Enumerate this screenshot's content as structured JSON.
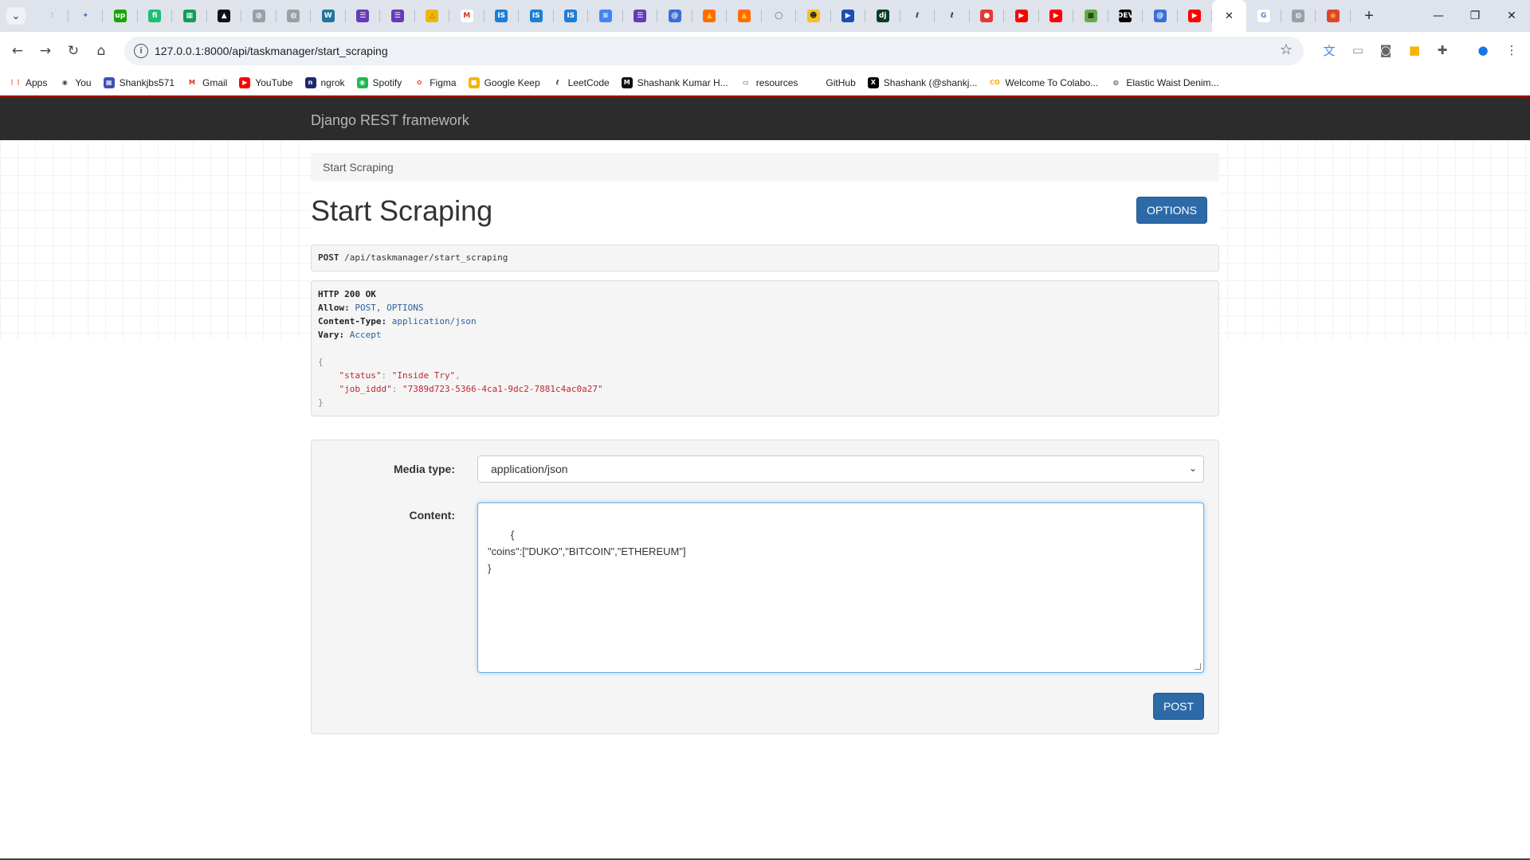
{
  "browser": {
    "tabs": [
      {
        "name": "moon",
        "glyph": "☽",
        "bg": "#dfe3eb",
        "fg": "#aab3c5"
      },
      {
        "name": "gemini",
        "glyph": "✦",
        "bg": "#dfe3eb",
        "fg": "#3b6fd6"
      },
      {
        "name": "upwork",
        "glyph": "up",
        "bg": "#14a800",
        "fg": "#ffffff"
      },
      {
        "name": "fiverr",
        "glyph": "fi",
        "bg": "#1dbf73",
        "fg": "#ffffff"
      },
      {
        "name": "sheets",
        "glyph": "▦",
        "bg": "#0f9d58",
        "fg": "#ffffff"
      },
      {
        "name": "notion-like",
        "glyph": "▲",
        "bg": "#111111",
        "fg": "#ffffff"
      },
      {
        "name": "globe-1",
        "glyph": "◍",
        "bg": "#9aa0a6",
        "fg": "#ffffff"
      },
      {
        "name": "globe-2",
        "glyph": "◍",
        "bg": "#9aa0a6",
        "fg": "#ffffff"
      },
      {
        "name": "wordpress",
        "glyph": "W",
        "bg": "#21759b",
        "fg": "#ffffff"
      },
      {
        "name": "forms-1",
        "glyph": "☰",
        "bg": "#673ab7",
        "fg": "#ffffff"
      },
      {
        "name": "forms-2",
        "glyph": "☰",
        "bg": "#673ab7",
        "fg": "#ffffff"
      },
      {
        "name": "drive",
        "glyph": "△",
        "bg": "#f4b400",
        "fg": "#0f9d58"
      },
      {
        "name": "gmail",
        "glyph": "M",
        "bg": "#ffffff",
        "fg": "#d93025"
      },
      {
        "name": "is-1",
        "glyph": "IS",
        "bg": "#1c7ed6",
        "fg": "#ffffff"
      },
      {
        "name": "is-2",
        "glyph": "IS",
        "bg": "#1c7ed6",
        "fg": "#ffffff"
      },
      {
        "name": "is-3",
        "glyph": "IS",
        "bg": "#1c7ed6",
        "fg": "#ffffff"
      },
      {
        "name": "docs",
        "glyph": "≡",
        "bg": "#4285f4",
        "fg": "#ffffff"
      },
      {
        "name": "forms-3",
        "glyph": "☰",
        "bg": "#673ab7",
        "fg": "#ffffff"
      },
      {
        "name": "messenger",
        "glyph": "@",
        "bg": "#3b6fd6",
        "fg": "#ffffff"
      },
      {
        "name": "fire-1",
        "glyph": "▲",
        "bg": "#ff6d00",
        "fg": "#ffca28"
      },
      {
        "name": "fire-2",
        "glyph": "▲",
        "bg": "#ff6d00",
        "fg": "#ffca28"
      },
      {
        "name": "github",
        "glyph": "◯",
        "bg": "#dfe3eb",
        "fg": "#555555"
      },
      {
        "name": "emoji",
        "glyph": "☻",
        "bg": "#f6c026",
        "fg": "#222222"
      },
      {
        "name": "play",
        "glyph": "▶",
        "bg": "#1a4fb5",
        "fg": "#ffffff"
      },
      {
        "name": "django",
        "glyph": "dj",
        "bg": "#0c3c26",
        "fg": "#ffffff"
      },
      {
        "name": "leetcode-1",
        "glyph": "ℓ",
        "bg": "#dfe3eb",
        "fg": "#222222"
      },
      {
        "name": "leetcode-2",
        "glyph": "ℓ",
        "bg": "#dfe3eb",
        "fg": "#222222"
      },
      {
        "name": "red-circle",
        "glyph": "●",
        "bg": "#e53935",
        "fg": "#ffffff"
      },
      {
        "name": "youtube-1",
        "glyph": "▶",
        "bg": "#ff0000",
        "fg": "#ffffff"
      },
      {
        "name": "youtube-2",
        "glyph": "▶",
        "bg": "#ff0000",
        "fg": "#ffffff"
      },
      {
        "name": "green-app",
        "glyph": "■",
        "bg": "#6aa84f",
        "fg": "#274e13"
      },
      {
        "name": "dev",
        "glyph": "DEV",
        "bg": "#000000",
        "fg": "#ffffff"
      },
      {
        "name": "messenger-2",
        "glyph": "@",
        "bg": "#3b6fd6",
        "fg": "#ffffff"
      },
      {
        "name": "youtube-3",
        "glyph": "▶",
        "bg": "#ff0000",
        "fg": "#ffffff"
      }
    ],
    "active_tab": {
      "name": "active",
      "close_glyph": "✕"
    },
    "after_tabs": [
      {
        "name": "google",
        "glyph": "G",
        "bg": "#ffffff",
        "fg": "#4285f4"
      },
      {
        "name": "globe-3",
        "glyph": "◍",
        "bg": "#9aa0a6",
        "fg": "#ffffff"
      },
      {
        "name": "chrome",
        "glyph": "◉",
        "bg": "#db4437",
        "fg": "#f4b400"
      }
    ],
    "new_tab_glyph": "+",
    "window_controls": {
      "minimize": "—",
      "restore": "❐",
      "close": "✕"
    },
    "nav": {
      "back": "←",
      "forward": "→",
      "reload": "↻",
      "home": "⌂"
    },
    "site_info_glyph": "i",
    "url": "127.0.0.1:8000/api/taskmanager/start_scraping",
    "star_glyph": "☆",
    "extensions": [
      {
        "name": "translate",
        "glyph": "文",
        "color": "#4285f4"
      },
      {
        "name": "cast",
        "glyph": "▭",
        "color": "#888888"
      },
      {
        "name": "camera",
        "glyph": "◙",
        "color": "#666666"
      },
      {
        "name": "keep",
        "glyph": "■",
        "color": "#f4b400"
      },
      {
        "name": "puzzle",
        "glyph": "✚",
        "color": "#555555"
      },
      {
        "name": "profile",
        "glyph": "●",
        "color": "#1a73e8"
      },
      {
        "name": "menu",
        "glyph": "⋮",
        "color": "#444444"
      }
    ],
    "bookmarks": [
      {
        "label": "Apps",
        "glyph": "⋮⋮",
        "bg": "#ffffff",
        "fg": "#e8453c"
      },
      {
        "label": "You",
        "glyph": "◉",
        "bg": "#ffffff",
        "fg": "#444444"
      },
      {
        "label": "Shankjbs571",
        "glyph": "▦",
        "bg": "#3f51b5",
        "fg": "#ffffff"
      },
      {
        "label": "Gmail",
        "glyph": "M",
        "bg": "#ffffff",
        "fg": "#d93025"
      },
      {
        "label": "YouTube",
        "glyph": "▶",
        "bg": "#ff0000",
        "fg": "#ffffff"
      },
      {
        "label": "ngrok",
        "glyph": "n",
        "bg": "#1f2a6b",
        "fg": "#ffffff"
      },
      {
        "label": "Spotify",
        "glyph": "◉",
        "bg": "#1db954",
        "fg": "#ffffff"
      },
      {
        "label": "Figma",
        "glyph": "✿",
        "bg": "#ffffff",
        "fg": "#f24e1e"
      },
      {
        "label": "Google Keep",
        "glyph": "■",
        "bg": "#f4b400",
        "fg": "#ffffff"
      },
      {
        "label": "LeetCode",
        "glyph": "ℓ",
        "bg": "#ffffff",
        "fg": "#222222"
      },
      {
        "label": "Shashank Kumar H...",
        "glyph": "M",
        "bg": "#111111",
        "fg": "#ffffff"
      },
      {
        "label": "resources",
        "glyph": "▭",
        "bg": "#ffffff",
        "fg": "#444444"
      },
      {
        "label": "GitHub",
        "glyph": "",
        "bg": "#ffffff",
        "fg": "#ffffff"
      },
      {
        "label": "Shashank (@shankj...",
        "glyph": "X",
        "bg": "#000000",
        "fg": "#ffffff"
      },
      {
        "label": "Welcome To Colabo...",
        "glyph": "CO",
        "bg": "#ffffff",
        "fg": "#f9ab00"
      },
      {
        "label": "Elastic Waist Denim...",
        "glyph": "◍",
        "bg": "#ffffff",
        "fg": "#444444"
      }
    ]
  },
  "drf": {
    "brand": "Django REST framework",
    "breadcrumb": "Start Scraping",
    "title": "Start Scraping",
    "options_label": "OPTIONS",
    "request": {
      "method": "POST",
      "path": "/api/taskmanager/start_scraping"
    },
    "response": {
      "status_line": "HTTP 200 OK",
      "headers": [
        {
          "key": "Allow:",
          "value": "POST, OPTIONS"
        },
        {
          "key": "Content-Type:",
          "value": "application/json"
        },
        {
          "key": "Vary:",
          "value": "Accept"
        }
      ],
      "open_brace": "{",
      "body": [
        {
          "key": "\"status\"",
          "value": "\"Inside Try\"",
          "trail": ","
        },
        {
          "key": "\"job_iddd\"",
          "value": "\"7389d723-5366-4ca1-9dc2-7881c4ac0a27\"",
          "trail": ""
        }
      ],
      "close_brace": "}"
    },
    "form": {
      "media_type_label": "Media type:",
      "media_type_value": "application/json",
      "content_label": "Content:",
      "content_value": "{\n\"coins\":[\"DUKO\",\"BITCOIN\",\"ETHEREUM\"]\n}",
      "post_label": "POST"
    }
  }
}
